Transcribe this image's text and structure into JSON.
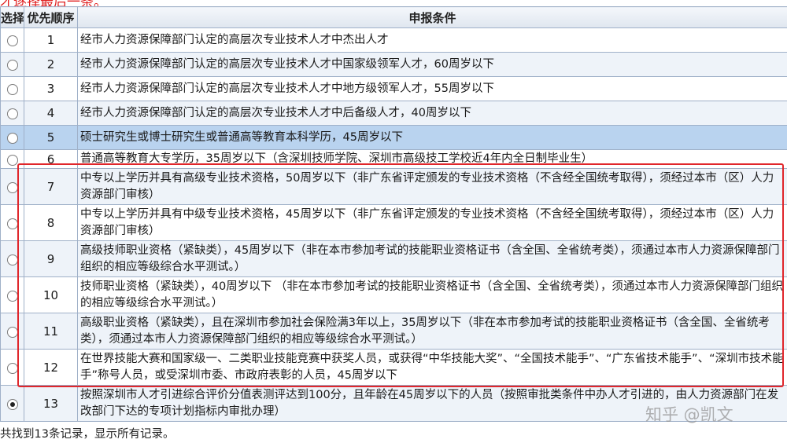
{
  "top_note": "才逐择最后一条。",
  "table": {
    "headers": {
      "select": "选择",
      "order": "优先顺序",
      "condition": "申报条件"
    },
    "rows": [
      {
        "order": "1",
        "condition": "经市人力资源保障部门认定的高层次专业技术人才中杰出人才",
        "checked": false
      },
      {
        "order": "2",
        "condition": "经市人力资源保障部门认定的高层次专业技术人才中国家级领军人才，60周岁以下",
        "checked": false
      },
      {
        "order": "3",
        "condition": "经市人力资源保障部门认定的高层次专业技术人才中地方级领军人才，55周岁以下",
        "checked": false
      },
      {
        "order": "4",
        "condition": "经市人力资源保障部门认定的高层次专业技术人才中后备级人才，40周岁以下",
        "checked": false
      },
      {
        "order": "5",
        "condition": "硕士研究生或博士研究生或普通高等教育本科学历，45周岁以下",
        "checked": false
      },
      {
        "order": "6",
        "condition": "普通高等教育大专学历，35周岁以下（含深圳技师学院、深圳市高级技工学校近4年内全日制毕业生）",
        "checked": false
      },
      {
        "order": "7",
        "condition": "中专以上学历并具有高级专业技术资格，50周岁以下（非广东省评定颁发的专业技术资格（不含经全国统考取得），须经过本市（区）人力资源部门审核）",
        "checked": false
      },
      {
        "order": "8",
        "condition": "中专以上学历并具有中级专业技术资格，45周岁以下（非广东省评定颁发的专业技术资格（不含经全国统考取得），须经过本市（区）人力资源部门审核）",
        "checked": false
      },
      {
        "order": "9",
        "condition": "高级技师职业资格（紧缺类），45周岁以下（非在本市参加考试的技能职业资格证书（含全国、全省统考类），须通过本市人力资源保障部门组织的相应等级综合水平测试。）",
        "checked": false
      },
      {
        "order": "10",
        "condition": "技师职业资格（紧缺类），40周岁以下 （非在本市参加考试的技能职业资格证书（含全国、全省统考类），须通过本市人力资源保障部门组织的相应等级综合水平测试。）",
        "checked": false
      },
      {
        "order": "11",
        "condition": "高级职业资格（紧缺类），且在深圳市参加社会保险满3年以上，35周岁以下（非在本市参加考试的技能职业资格证书（含全国、全省统考类），须通过本市人力资源保障部门组织的相应等级综合水平测试。）",
        "checked": false
      },
      {
        "order": "12",
        "condition": "在世界技能大赛和国家级一、二类职业技能竞赛中获奖人员，或获得“中华技能大奖”、“全国技术能手”、“广东省技术能手”、“深圳市技术能手”称号人员，或受深圳市委、市政府表彰的人员，45周岁以下",
        "checked": false
      },
      {
        "order": "13",
        "condition": "按照深圳市人才引进综合评价分值表测评达到100分，且年龄在45周岁以下的人员（按照审批类条件中办人才引进的，由人力资源部门在发改部门下达的专项计划指标内审批办理）",
        "checked": true
      }
    ]
  },
  "footer": "共找到13条记录，显示所有记录。",
  "watermark": "知乎 @凯文",
  "colors": {
    "highlight_box": "#e0262b",
    "selected_row": "#b9d3ef",
    "border": "#9fb0c8"
  }
}
